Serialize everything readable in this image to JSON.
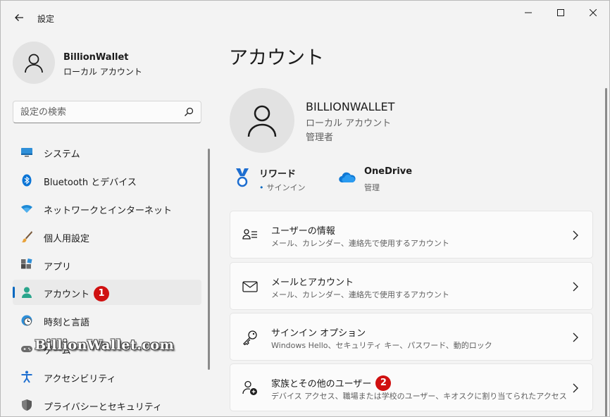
{
  "window": {
    "title": "設定"
  },
  "user": {
    "name": "BillionWallet",
    "type": "ローカル アカウント"
  },
  "search": {
    "placeholder": "設定の検索"
  },
  "nav": {
    "items": [
      {
        "label": "システム",
        "icon": "monitor-icon"
      },
      {
        "label": "Bluetooth とデバイス",
        "icon": "bluetooth-icon"
      },
      {
        "label": "ネットワークとインターネット",
        "icon": "wifi-icon"
      },
      {
        "label": "個人用設定",
        "icon": "brush-icon"
      },
      {
        "label": "アプリ",
        "icon": "apps-icon"
      },
      {
        "label": "アカウント",
        "icon": "account-icon",
        "active": true,
        "badge": "1"
      },
      {
        "label": "時刻と言語",
        "icon": "globe-clock-icon"
      },
      {
        "label": "ゲーム",
        "icon": "gamepad-icon"
      },
      {
        "label": "アクセシビリティ",
        "icon": "accessibility-icon"
      },
      {
        "label": "プライバシーとセキュリティ",
        "icon": "shield-icon"
      }
    ]
  },
  "watermark": "BillionWallet.com",
  "main": {
    "title": "アカウント",
    "profile": {
      "name": "BILLIONWALLET",
      "type": "ローカル アカウント",
      "role": "管理者"
    },
    "rewards": {
      "title": "リワード",
      "sub": "サインイン"
    },
    "onedrive": {
      "title": "OneDrive",
      "sub": "管理"
    },
    "cards": [
      {
        "title": "ユーザーの情報",
        "sub": "メール、カレンダー、連絡先で使用するアカウント",
        "icon": "user-info-icon"
      },
      {
        "title": "メールとアカウント",
        "sub": "メール、カレンダー、連絡先で使用するアカウント",
        "icon": "mail-icon"
      },
      {
        "title": "サインイン オプション",
        "sub": "Windows Hello、セキュリティ キー、パスワード、動的ロック",
        "icon": "key-icon"
      },
      {
        "title": "家族とその他のユーザー",
        "sub": "デバイス アクセス、職場または学校のユーザー、キオスクに割り当てられたアクセス",
        "icon": "add-person-icon",
        "badge": "2"
      }
    ]
  },
  "colors": {
    "accent": "#0067c0",
    "badge": "#d01010",
    "background": "#f3f3f3",
    "card": "#fbfbfb"
  }
}
